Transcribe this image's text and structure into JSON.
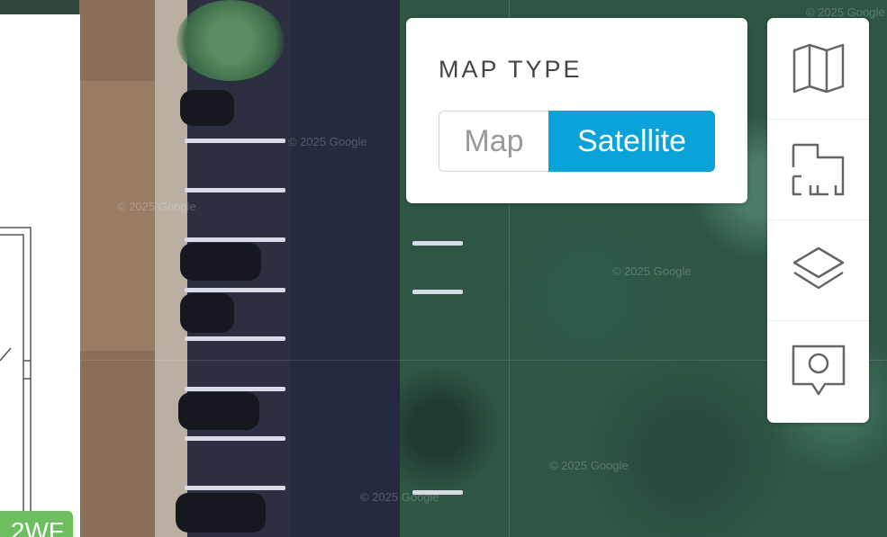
{
  "map": {
    "watermark": "© 2025 Google"
  },
  "floor_plan": {
    "unit_label": "2WF",
    "unit_label_color": "#6cbe5f"
  },
  "map_type": {
    "title": "MAP TYPE",
    "options": [
      "Map",
      "Satellite"
    ],
    "selected": "Satellite",
    "accent_color": "#0aa3d9"
  },
  "toolbar": {
    "buttons": [
      {
        "icon": "map-icon"
      },
      {
        "icon": "floor-plan-icon"
      },
      {
        "icon": "layers-icon"
      },
      {
        "icon": "place-marker-icon"
      }
    ]
  }
}
